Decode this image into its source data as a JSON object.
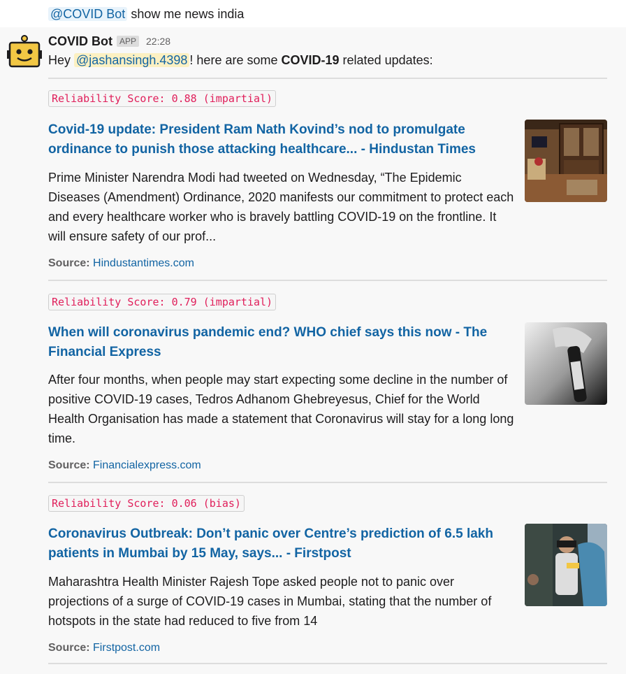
{
  "user_message": {
    "mention": "@COVID Bot",
    "text": "show me news india"
  },
  "bot_message": {
    "name": "COVID Bot",
    "badge": "APP",
    "time": "22:28",
    "intro_prefix": "Hey",
    "intro_mention": "@jashansingh.4398",
    "intro_mid": "! here are some",
    "intro_bold": "COVID-19",
    "intro_suffix": "related updates:"
  },
  "source_label": "Source:",
  "news": [
    {
      "score": "Reliability Score: 0.88 (impartial)",
      "title": "Covid-19 update: President Ram Nath Kovind’s nod to promulgate ordinance to punish those attacking healthcare... - Hindustan Times",
      "description": "Prime Minister Narendra Modi had tweeted on Wednesday, “The Epidemic Diseases (Amendment) Ordinance, 2020 manifests our commitment to protect each and every healthcare worker who is bravely battling COVID-19 on the frontline. It will ensure safety of our prof...",
      "source": "Hindustantimes.com"
    },
    {
      "score": "Reliability Score: 0.79 (impartial)",
      "title": "When will coronavirus pandemic end? WHO chief says this now - The Financial Express",
      "description": "After four months, when people may start expecting some decline in the number of positive COVID-19 cases, Tedros Adhanom Ghebreyesus, Chief for the World Health Organisation has made a statement that Coronavirus will stay for a long long time.",
      "source": "Financialexpress.com"
    },
    {
      "score": "Reliability Score: 0.06 (bias)",
      "title": "Coronavirus Outbreak: Don’t panic over Centre’s prediction of 6.5 lakh patients in Mumbai by 15 May, says... - Firstpost",
      "description": "Maharashtra Health Minister Rajesh Tope asked people not to panic over projections of a surge of COVID-19 cases in Mumbai, stating that the number of hotspots in the state had reduced to five from 14",
      "source": "Firstpost.com"
    }
  ],
  "colors": {
    "link": "#1264a3",
    "score_text": "#e01e5a",
    "mention_bg": "#e8f3fb",
    "user_mention_bg": "#fcf0c2",
    "hover_bg": "#f8f8f8"
  },
  "icons": {
    "avatar": "robot-avatar-icon"
  }
}
